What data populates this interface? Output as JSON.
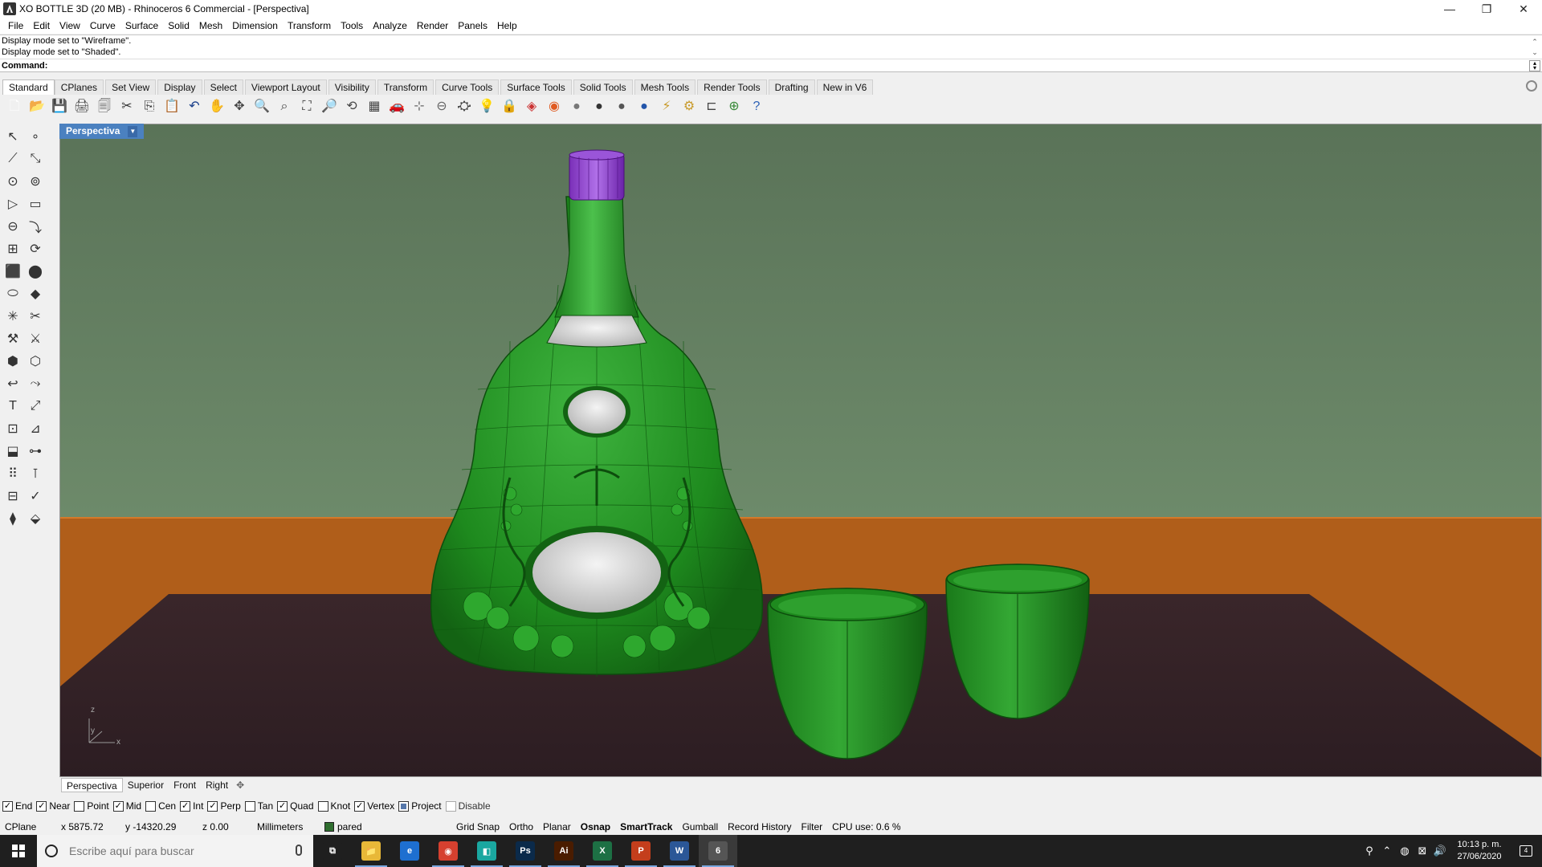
{
  "window": {
    "title": "XO BOTTLE 3D (20 MB) - Rhinoceros 6 Commercial - [Perspectiva]",
    "minimize": "—",
    "restore": "❐",
    "close": "✕"
  },
  "menu": [
    "File",
    "Edit",
    "View",
    "Curve",
    "Surface",
    "Solid",
    "Mesh",
    "Dimension",
    "Transform",
    "Tools",
    "Analyze",
    "Render",
    "Panels",
    "Help"
  ],
  "history": [
    "Display mode set to \"Wireframe\".",
    "Display mode set to \"Shaded\"."
  ],
  "command": {
    "label": "Command:",
    "value": ""
  },
  "toolbar_tabs": [
    "Standard",
    "CPlanes",
    "Set View",
    "Display",
    "Select",
    "Viewport Layout",
    "Visibility",
    "Transform",
    "Curve Tools",
    "Surface Tools",
    "Solid Tools",
    "Mesh Tools",
    "Render Tools",
    "Drafting",
    "New in V6"
  ],
  "toolbar_icons": [
    {
      "name": "new-icon",
      "glyph": "🗋",
      "color": "#ffffff"
    },
    {
      "name": "open-icon",
      "glyph": "📂",
      "color": "#e8c54a"
    },
    {
      "name": "save-icon",
      "glyph": "💾",
      "color": "#555555"
    },
    {
      "name": "print-icon",
      "glyph": "🖨",
      "color": "#444444"
    },
    {
      "name": "template-icon",
      "glyph": "🗐",
      "color": "#555555"
    },
    {
      "name": "cut-icon",
      "glyph": "✂",
      "color": "#333333"
    },
    {
      "name": "copy-icon",
      "glyph": "⎘",
      "color": "#333333"
    },
    {
      "name": "paste-icon",
      "glyph": "📋",
      "color": "#c49a3a"
    },
    {
      "name": "undo-icon",
      "glyph": "↶",
      "color": "#1a3f8a"
    },
    {
      "name": "pan-icon",
      "glyph": "✋",
      "color": "#444444"
    },
    {
      "name": "rotate-view-icon",
      "glyph": "✥",
      "color": "#444444"
    },
    {
      "name": "zoom-icon",
      "glyph": "🔍",
      "color": "#444444"
    },
    {
      "name": "zoom-window-icon",
      "glyph": "⌕",
      "color": "#444444"
    },
    {
      "name": "zoom-extents-icon",
      "glyph": "⛶",
      "color": "#444444"
    },
    {
      "name": "zoom-selected-icon",
      "glyph": "🔎",
      "color": "#444444"
    },
    {
      "name": "undo-view-icon",
      "glyph": "⟲",
      "color": "#444444"
    },
    {
      "name": "viewport-layout-icon",
      "glyph": "▦",
      "color": "#444444"
    },
    {
      "name": "car-icon",
      "glyph": "🚗",
      "color": "#cc2222"
    },
    {
      "name": "point-on-icon",
      "glyph": "⊹",
      "color": "#666666"
    },
    {
      "name": "cplane-icon",
      "glyph": "⊖",
      "color": "#666666"
    },
    {
      "name": "gumball-icon",
      "glyph": "⛮",
      "color": "#444444"
    },
    {
      "name": "light-icon",
      "glyph": "💡",
      "color": "#888888"
    },
    {
      "name": "lock-icon",
      "glyph": "🔒",
      "color": "#444444"
    },
    {
      "name": "layer-icon",
      "glyph": "◈",
      "color": "#cc3333"
    },
    {
      "name": "color-wheel-icon",
      "glyph": "◉",
      "color": "#e05a20"
    },
    {
      "name": "material-sphere-icon",
      "glyph": "●",
      "color": "#777777"
    },
    {
      "name": "render-sphere-icon",
      "glyph": "●",
      "color": "#333333"
    },
    {
      "name": "render-preview-icon",
      "glyph": "●",
      "color": "#555555"
    },
    {
      "name": "environment-sphere-icon",
      "glyph": "●",
      "color": "#2255aa"
    },
    {
      "name": "light-tool-icon",
      "glyph": "⚡",
      "color": "#c89a2a"
    },
    {
      "name": "options-gear-icon",
      "glyph": "⚙",
      "color": "#c89a2a"
    },
    {
      "name": "dimension-icon",
      "glyph": "⊏",
      "color": "#444444"
    },
    {
      "name": "render-globe-icon",
      "glyph": "⊕",
      "color": "#3a8a3a"
    },
    {
      "name": "help-icon",
      "glyph": "?",
      "color": "#2b5fb5"
    }
  ],
  "side_icons": [
    [
      "select-arrow-icon",
      "↖",
      "point-icon",
      "∘"
    ],
    [
      "polyline-icon",
      "⟋",
      "curve-points-icon",
      "⤡"
    ],
    [
      "circle-icon",
      "⊙",
      "ellipse-icon",
      "⊚"
    ],
    [
      "polygon-icon",
      "▷",
      "rectangle-icon",
      "▭"
    ],
    [
      "arc-icon",
      "⊖",
      "fillet-curve-icon",
      "⤵"
    ],
    [
      "surface-points-icon",
      "⊞",
      "revolve-icon",
      "⟳"
    ],
    [
      "box-icon",
      "⬛",
      "boolean-icon",
      "⬤"
    ],
    [
      "extrude-icon",
      "⬭",
      "mesh-icon",
      "◆"
    ],
    [
      "explode-icon",
      "✳",
      "trim-icon",
      "✂"
    ],
    [
      "join-icon",
      "⚒",
      "split-icon",
      "⚔"
    ],
    [
      "group-icon",
      "⬢",
      "ungroup-icon",
      "⬡"
    ],
    [
      "move-icon",
      "↩",
      "copy-tool-icon",
      "⤳"
    ],
    [
      "text-icon",
      "T",
      "scale-icon",
      "⤢"
    ],
    [
      "array-icon",
      "⊡",
      "mirror-icon",
      "⊿"
    ],
    [
      "solid-box-icon",
      "⬓",
      "dimension-linear-icon",
      "⊶"
    ],
    [
      "grid-array-icon",
      "⠿",
      "analyze-icon",
      "⊺"
    ],
    [
      "properties-icon",
      "⊟",
      "check-icon",
      "✓"
    ],
    [
      "render-tool-icon",
      "⧫",
      "material-icon",
      "⬙"
    ]
  ],
  "viewport": {
    "label": "Perspectiva",
    "axes": {
      "z": "z",
      "y": "y",
      "x": "x"
    }
  },
  "viewport_tabs": [
    "Perspectiva",
    "Superior",
    "Front",
    "Right"
  ],
  "osnaps": [
    {
      "label": "End",
      "state": "checked"
    },
    {
      "label": "Near",
      "state": "checked"
    },
    {
      "label": "Point",
      "state": "unchecked"
    },
    {
      "label": "Mid",
      "state": "checked"
    },
    {
      "label": "Cen",
      "state": "unchecked"
    },
    {
      "label": "Int",
      "state": "checked"
    },
    {
      "label": "Perp",
      "state": "checked"
    },
    {
      "label": "Tan",
      "state": "unchecked"
    },
    {
      "label": "Quad",
      "state": "checked"
    },
    {
      "label": "Knot",
      "state": "unchecked"
    },
    {
      "label": "Vertex",
      "state": "checked"
    },
    {
      "label": "Project",
      "state": "filled"
    },
    {
      "label": "Disable",
      "state": "disabled"
    }
  ],
  "status": {
    "cplane": "CPlane",
    "x": "x 5875.72",
    "y": "y -14320.29",
    "z": "z 0.00",
    "units": "Millimeters",
    "layer": "pared",
    "grid_snap": "Grid Snap",
    "ortho": "Ortho",
    "planar": "Planar",
    "osnap": "Osnap",
    "smarttrack": "SmartTrack",
    "gumball": "Gumball",
    "record_history": "Record History",
    "filter": "Filter",
    "cpu": "CPU use: 0.6 %"
  },
  "taskbar": {
    "search_placeholder": "Escribe aquí para buscar",
    "apps": [
      {
        "name": "task-view-icon",
        "label": "⧉",
        "color": "#1f1f1f"
      },
      {
        "name": "file-explorer-icon",
        "label": "📁",
        "color": "#e8b838"
      },
      {
        "name": "edge-icon",
        "label": "e",
        "color": "#1e6fd0"
      },
      {
        "name": "chrome-icon",
        "label": "◉",
        "color": "#d6402f"
      },
      {
        "name": "app-teal-icon",
        "label": "◧",
        "color": "#1aa7a0"
      },
      {
        "name": "photoshop-icon",
        "label": "Ps",
        "color": "#0b2a4a"
      },
      {
        "name": "illustrator-icon",
        "label": "Ai",
        "color": "#4a1c00"
      },
      {
        "name": "excel-icon",
        "label": "X",
        "color": "#1d7044"
      },
      {
        "name": "powerpoint-icon",
        "label": "P",
        "color": "#c43e1c"
      },
      {
        "name": "word-icon",
        "label": "W",
        "color": "#2b5797"
      },
      {
        "name": "rhino-icon",
        "label": "6",
        "color": "#555555"
      }
    ],
    "tray": [
      {
        "name": "person-icon",
        "glyph": "⚲"
      },
      {
        "name": "chevron-up-icon",
        "glyph": "⌃"
      },
      {
        "name": "tray-app-icon",
        "glyph": "◍"
      },
      {
        "name": "network-icon",
        "glyph": "⊠"
      },
      {
        "name": "volume-icon",
        "glyph": "🔊"
      }
    ],
    "time": "10:13 p. m.",
    "date": "27/06/2020",
    "notifications": "4"
  }
}
